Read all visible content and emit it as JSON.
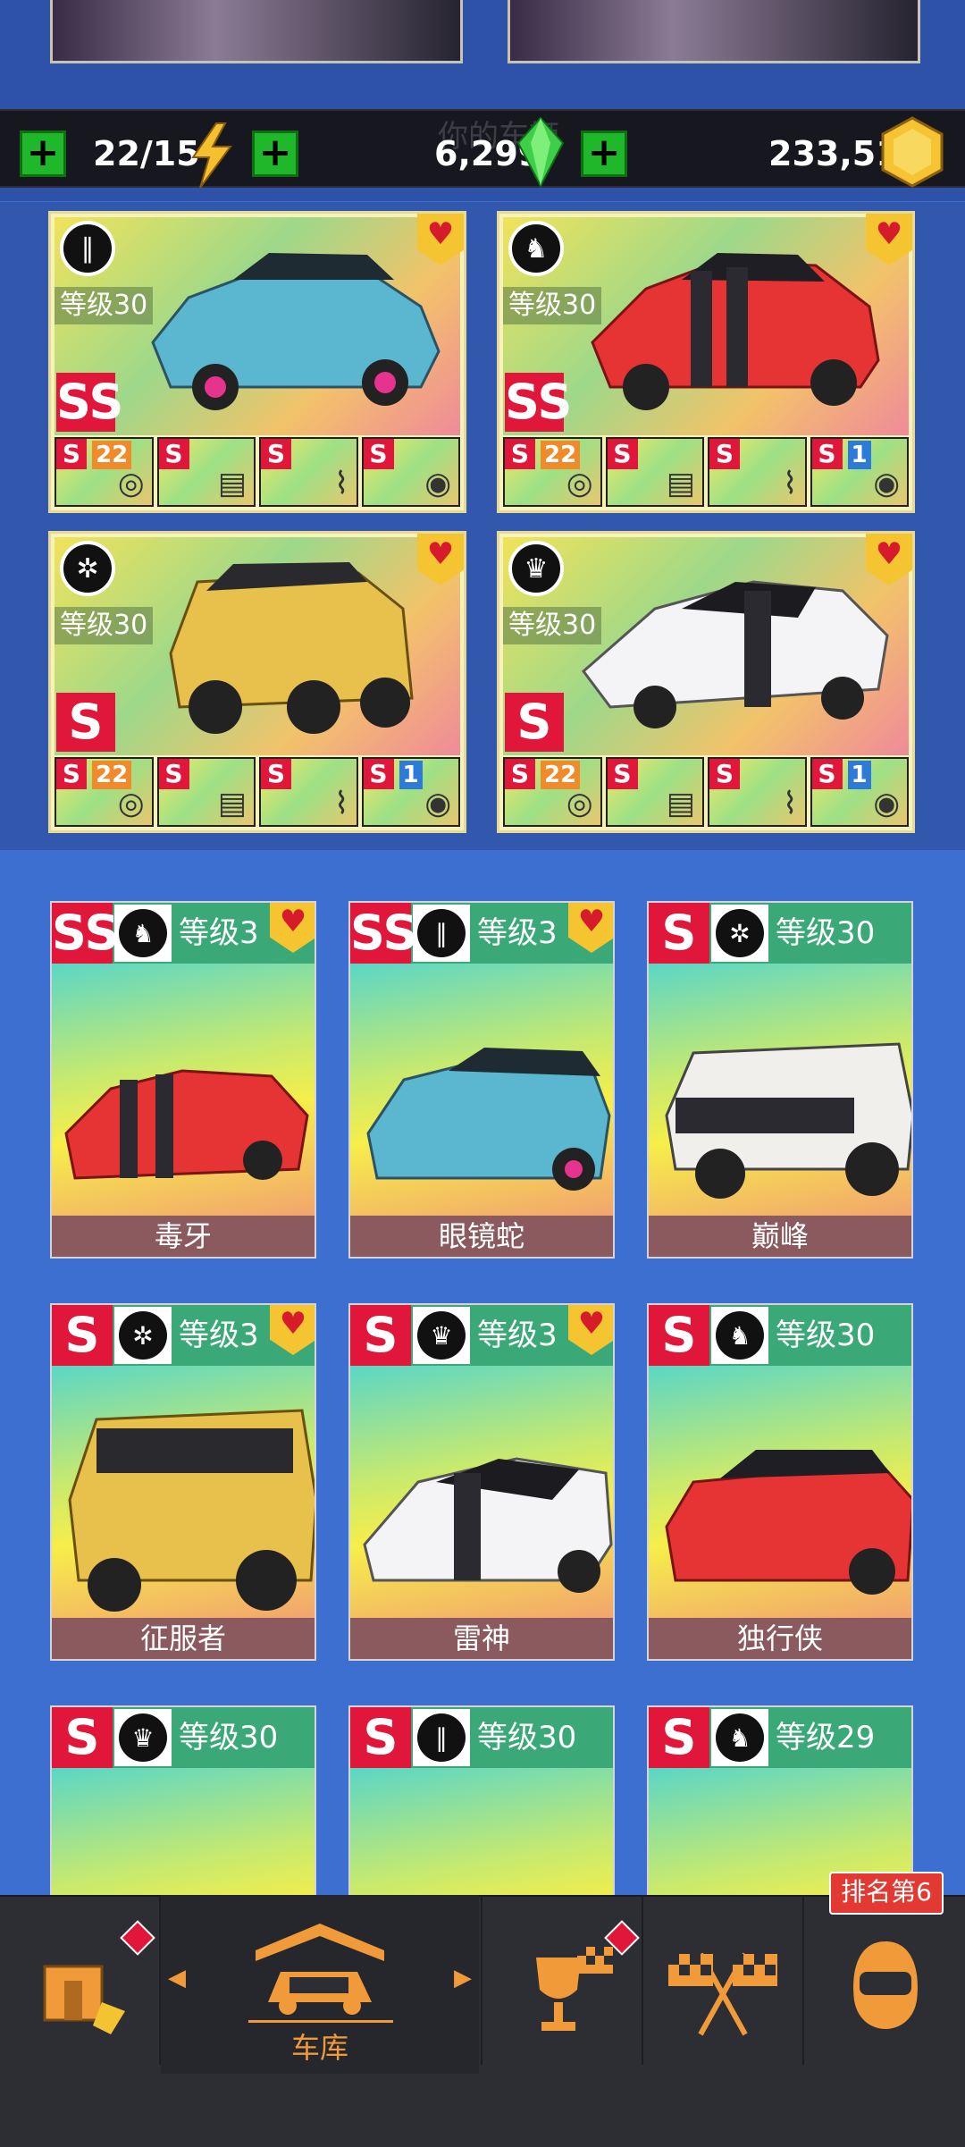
{
  "resources": {
    "title_ghost": "你的车辆",
    "energy": "22/15",
    "gems": "6,299",
    "coins": "233,514"
  },
  "favorites": [
    {
      "level": "等级30",
      "rank": "SS",
      "class_icon": "road-icon",
      "car": "blue-sedan",
      "parts": [
        {
          "rank": "S",
          "badge": "22"
        },
        {
          "rank": "S",
          "badge": ""
        },
        {
          "rank": "S",
          "badge": ""
        },
        {
          "rank": "S",
          "badge": ""
        }
      ]
    },
    {
      "level": "等级30",
      "rank": "SS",
      "class_icon": "horse-icon",
      "car": "red-viper",
      "parts": [
        {
          "rank": "S",
          "badge": "22"
        },
        {
          "rank": "S",
          "badge": ""
        },
        {
          "rank": "S",
          "badge": ""
        },
        {
          "rank": "S",
          "badge": "1"
        }
      ]
    },
    {
      "level": "等级30",
      "rank": "S",
      "class_icon": "wheel-icon",
      "car": "yellow-6x6",
      "parts": [
        {
          "rank": "S",
          "badge": "22"
        },
        {
          "rank": "S",
          "badge": ""
        },
        {
          "rank": "S",
          "badge": ""
        },
        {
          "rank": "S",
          "badge": "1"
        }
      ]
    },
    {
      "level": "等级30",
      "rank": "S",
      "class_icon": "crown-icon",
      "car": "white-hyper",
      "parts": [
        {
          "rank": "S",
          "badge": "22"
        },
        {
          "rank": "S",
          "badge": ""
        },
        {
          "rank": "S",
          "badge": ""
        },
        {
          "rank": "S",
          "badge": "1"
        }
      ]
    }
  ],
  "garage": [
    {
      "rank": "SS",
      "class_icon": "horse-icon",
      "level": "等级3",
      "name": "毒牙",
      "fav": true
    },
    {
      "rank": "SS",
      "class_icon": "road-icon",
      "level": "等级3",
      "name": "眼镜蛇",
      "fav": true
    },
    {
      "rank": "S",
      "class_icon": "wheel-icon",
      "level": "等级30",
      "name": "巅峰",
      "fav": false
    },
    {
      "rank": "S",
      "class_icon": "wheel-icon",
      "level": "等级3",
      "name": "征服者",
      "fav": true
    },
    {
      "rank": "S",
      "class_icon": "crown-icon",
      "level": "等级3",
      "name": "雷神",
      "fav": true
    },
    {
      "rank": "S",
      "class_icon": "horse-icon",
      "level": "等级30",
      "name": "独行侠",
      "fav": false
    },
    {
      "rank": "S",
      "class_icon": "crown-icon",
      "level": "等级30",
      "name": "",
      "fav": false
    },
    {
      "rank": "S",
      "class_icon": "road-icon",
      "level": "等级30",
      "name": "",
      "fav": false
    },
    {
      "rank": "S",
      "class_icon": "horse-icon",
      "level": "等级29",
      "name": "",
      "fav": false
    }
  ],
  "nav": {
    "garage_label": "车库",
    "rank_label": "排名第6"
  },
  "colors": {
    "accent": "#e0163a",
    "plus": "#1fb82a",
    "nav_orange": "#f09a3a"
  }
}
